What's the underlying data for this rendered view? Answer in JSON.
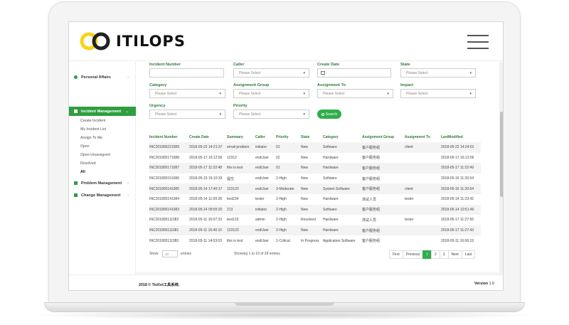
{
  "brand": {
    "name": "ITILOPS",
    "colors": {
      "accent": "#2e9e3e",
      "logo_yellow": "#f7d417",
      "logo_dark": "#222222"
    }
  },
  "header": {
    "menu_icon": "hamburger-icon"
  },
  "sidebar": {
    "items": [
      {
        "label": "Personal Affairs",
        "icon": "user-icon"
      },
      {
        "label": "Incident Management",
        "icon": "list-icon",
        "active": true
      },
      {
        "label": "Problem Management",
        "icon": "problem-icon"
      },
      {
        "label": "Change Management",
        "icon": "change-icon"
      }
    ],
    "sub_items": [
      "Create Incident",
      "My Incident List",
      "Assign To Me",
      "Open",
      "Open-Unassigned",
      "Resolved",
      "All"
    ]
  },
  "filters": {
    "incident_number": {
      "label": "Incident Number",
      "value": ""
    },
    "caller": {
      "label": "Caller",
      "placeholder": "Please Select"
    },
    "create_date": {
      "label": "Create Date",
      "value": ""
    },
    "state": {
      "label": "State",
      "placeholder": "Please Select"
    },
    "category": {
      "label": "Category",
      "placeholder": "Please Select"
    },
    "assignment_group": {
      "label": "Assignment Group",
      "placeholder": "Please Select"
    },
    "assignment_to": {
      "label": "Assignment To",
      "placeholder": "Please Select"
    },
    "impact": {
      "label": "Impact",
      "placeholder": "Please Select"
    },
    "urgency": {
      "label": "Urgency",
      "placeholder": "Please Select"
    },
    "priority": {
      "label": "Priority",
      "placeholder": "Please Select"
    },
    "search_label": "Search"
  },
  "table": {
    "columns": [
      "Incident Number",
      "Create Date",
      "Summary",
      "Caller",
      "Priority",
      "State",
      "Category",
      "Assignment Group",
      "Assignment To",
      "LastModified"
    ],
    "rows": [
      [
        "INC201805221089",
        "2018-05-22 14:21:37",
        "email problem",
        "initiator",
        "01",
        "New",
        "Software",
        "客户服务组",
        "client",
        "2018-05-22 14:24:01"
      ],
      [
        "INC201805171088",
        "2018-05-17 16:12:56",
        "12312",
        "endUser",
        "02",
        "New",
        "Hardware",
        "客户服务组",
        "",
        "2018-05-17 16:12:56"
      ],
      [
        "INC201805171087",
        "2018-05-17 11:22:48",
        "this is test",
        "endUser",
        "01",
        "New",
        "Hardware",
        "客户服务组",
        "",
        "2018-05-17 11:22:49"
      ],
      [
        "INC201805151086",
        "2018-05-15 16:10:33",
        "提交",
        "endUser",
        "2-High",
        "New",
        "Software",
        "客户服务组",
        "",
        "2018-05-16 11:20:54"
      ],
      [
        "INC201805141085",
        "2018-05-14 17:40:17",
        "123123",
        "endUser",
        "3-Moderate",
        "New",
        "System Software",
        "客户服务组",
        "client",
        "2018-05-16 11:20:54"
      ],
      [
        "INC201805141084",
        "2018-05-14 11:00:28",
        "test234",
        "tester",
        "2-High",
        "New",
        "Hardware",
        "测试人员",
        "tester",
        "2018-05-14 11:23:42"
      ],
      [
        "INC201805141083",
        "2018-05-14 09:55:20",
        "213",
        "initiator",
        "2-High",
        "New",
        "Software",
        "客户服务组",
        "",
        "2018-05-14 10:51:46"
      ],
      [
        "INC201805111082",
        "2018-05-11 16:07:33",
        "test123",
        "admin",
        "2-High",
        "Resolved",
        "Hardware",
        "测试人员",
        "tester",
        "2018-05-17 11:27:56"
      ],
      [
        "INC201805111081",
        "2018-05-11 15:40:10",
        "123123",
        "endUser",
        "2-High",
        "New",
        "Hardware",
        "客户服务组",
        "",
        "2018-05-17 11:27:43"
      ],
      [
        "INC201805111080",
        "2018-05-11 14:03:03",
        "this is test",
        "endUser",
        "1-Critical",
        "In Progress",
        "Application Software",
        "客户服务组",
        "",
        "2018-05-11 16:06:19"
      ]
    ]
  },
  "pagination": {
    "show_label": "Show",
    "page_size": "10",
    "entries_label": "entries",
    "summary": "Showing 1 to 10 of 28 entries",
    "buttons": [
      "First",
      "Previous",
      "1",
      "2",
      "3",
      "Next",
      "Last"
    ],
    "current": "1"
  },
  "footer": {
    "copyright": "2018 © TicKet工具系统.",
    "version_label": "Version",
    "version": "1.0"
  }
}
